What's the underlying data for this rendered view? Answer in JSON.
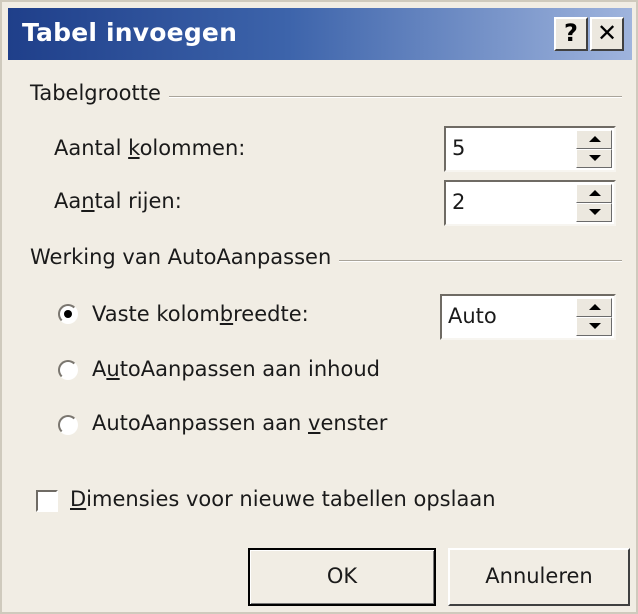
{
  "dialog": {
    "title": "Tabel invoegen",
    "help_glyph": "?",
    "close_glyph": "✕"
  },
  "table_size": {
    "group_label": "Tabelgrootte",
    "columns": {
      "label_pre": "Aantal ",
      "label_u": "k",
      "label_post": "olommen:",
      "value": "5"
    },
    "rows": {
      "label_pre": "Aa",
      "label_u": "n",
      "label_post": "tal rijen:",
      "value": "2"
    }
  },
  "autofit": {
    "group_label": "Werking van AutoAanpassen",
    "fixed": {
      "label_pre": "Vaste kolom",
      "label_u": "b",
      "label_post": "reedte:",
      "value": "Auto",
      "selected": true
    },
    "content": {
      "label_pre": "A",
      "label_u": "u",
      "label_post": "toAanpassen aan inhoud",
      "selected": false
    },
    "window": {
      "label_pre": "AutoAanpassen aan ",
      "label_u": "v",
      "label_post": "enster",
      "selected": false
    }
  },
  "remember": {
    "label_u": "D",
    "label_post": "imensies voor nieuwe tabellen opslaan",
    "checked": false
  },
  "buttons": {
    "ok": "OK",
    "cancel": "Annuleren"
  },
  "colors": {
    "titlebar_start": "#1f3f8a",
    "titlebar_end": "#9fb4dd",
    "dialog_bg": "#f1ede4"
  }
}
